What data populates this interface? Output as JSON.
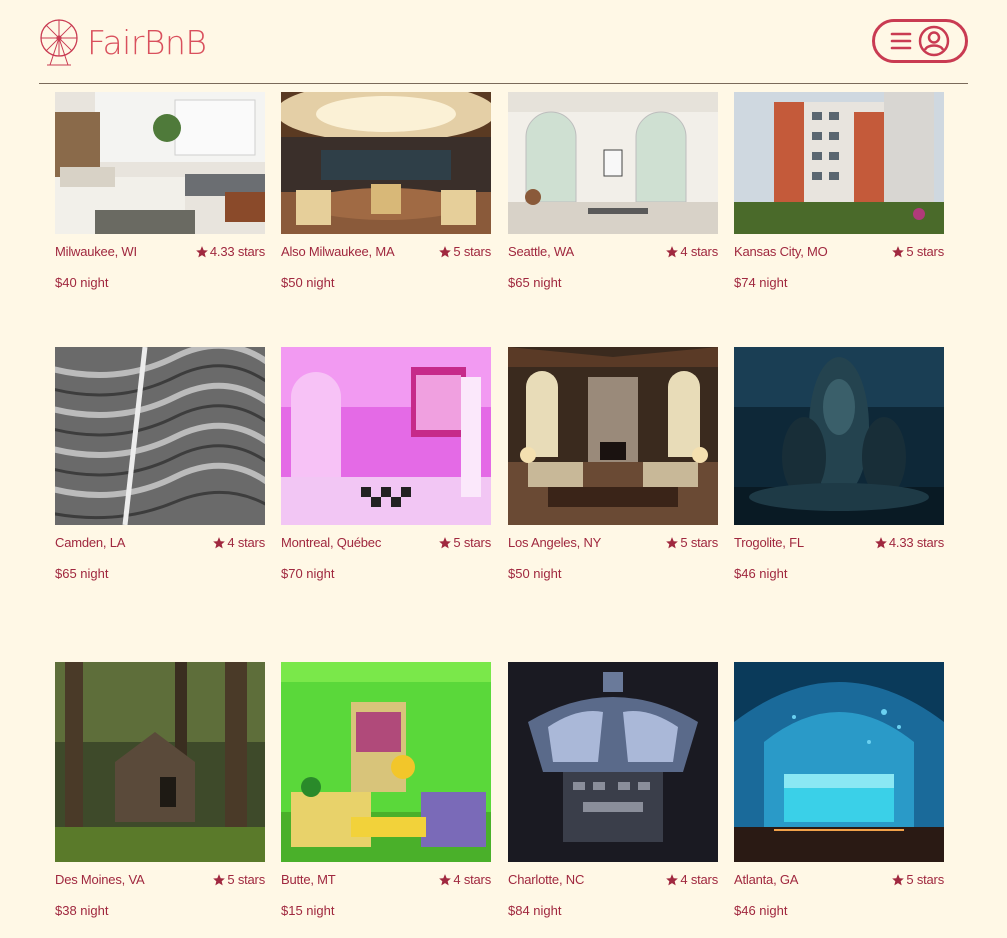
{
  "app": {
    "name": "FairBnB"
  },
  "header": {
    "menu_icon": "hamburger-icon",
    "user_icon": "user-circle-icon"
  },
  "colors": {
    "background": "#fff8e6",
    "accent": "#c93b52",
    "text": "#a0283f"
  },
  "listings": [
    {
      "location": "Milwaukee, WI",
      "rating": "4.33 stars",
      "price": "$40 night"
    },
    {
      "location": "Also Milwaukee, MA",
      "rating": "5 stars",
      "price": "$50 night"
    },
    {
      "location": "Seattle, WA",
      "rating": "4 stars",
      "price": "$65 night"
    },
    {
      "location": "Kansas City, MO",
      "rating": "5 stars",
      "price": "$74 night"
    },
    {
      "location": "Camden, LA",
      "rating": "4 stars",
      "price": "$65 night"
    },
    {
      "location": "Montreal, Québec",
      "rating": "5 stars",
      "price": "$70 night"
    },
    {
      "location": "Los Angeles, NY",
      "rating": "5 stars",
      "price": "$50 night"
    },
    {
      "location": "Trogolite, FL",
      "rating": "4.33 stars",
      "price": "$46 night"
    },
    {
      "location": "Des Moines, VA",
      "rating": "5 stars",
      "price": "$38 night"
    },
    {
      "location": "Butte, MT",
      "rating": "4 stars",
      "price": "$15 night"
    },
    {
      "location": "Charlotte, NC",
      "rating": "4 stars",
      "price": "$84 night"
    },
    {
      "location": "Atlanta, GA",
      "rating": "5 stars",
      "price": "$46 night"
    }
  ]
}
